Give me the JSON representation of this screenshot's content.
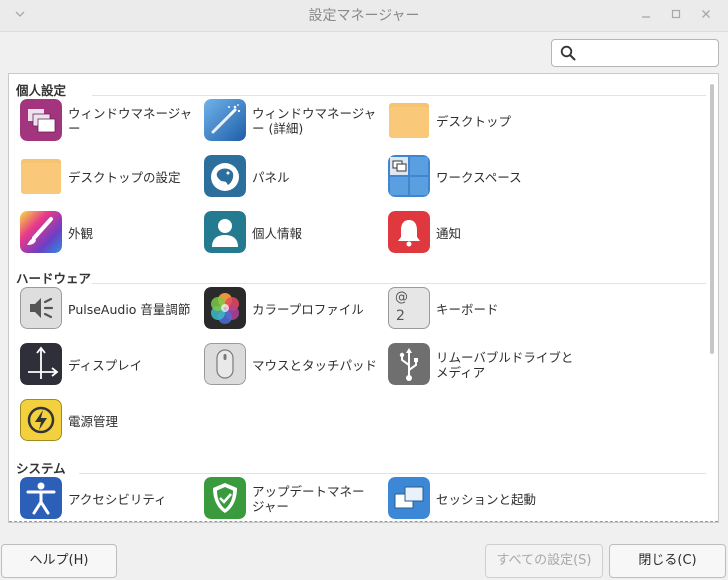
{
  "window": {
    "title": "設定マネージャー"
  },
  "search": {
    "value": "",
    "placeholder": ""
  },
  "categories": {
    "personal": {
      "title": "個人設定",
      "items": [
        {
          "label": "ウィンドウマネージャー",
          "icon": "window-manager-icon"
        },
        {
          "label": "ウィンドウマネージャー (詳細)",
          "icon": "window-manager-tweaks-icon"
        },
        {
          "label": "デスクトップ",
          "icon": "desktop-folder-icon"
        },
        {
          "label": "デスクトップの設定",
          "icon": "desktop-settings-folder-icon"
        },
        {
          "label": "パネル",
          "icon": "panel-icon"
        },
        {
          "label": "ワークスペース",
          "icon": "workspaces-icon"
        },
        {
          "label": "外観",
          "icon": "appearance-icon"
        },
        {
          "label": "個人情報",
          "icon": "user-info-icon"
        },
        {
          "label": "通知",
          "icon": "notification-bell-icon"
        }
      ]
    },
    "hardware": {
      "title": "ハードウェア",
      "items": [
        {
          "label": "PulseAudio 音量調節",
          "icon": "speaker-icon"
        },
        {
          "label": "カラープロファイル",
          "icon": "color-profile-icon"
        },
        {
          "label": "キーボード",
          "icon": "keyboard-key-icon",
          "key_top": "@",
          "key_bottom": "2"
        },
        {
          "label": "ディスプレイ",
          "icon": "display-icon"
        },
        {
          "label": "マウスとタッチパッド",
          "icon": "mouse-icon"
        },
        {
          "label": "リムーバブルドライブとメディア",
          "icon": "usb-icon"
        },
        {
          "label": "電源管理",
          "icon": "power-icon"
        }
      ]
    },
    "system": {
      "title": "システム",
      "items": [
        {
          "label": "アクセシビリティ",
          "icon": "accessibility-icon"
        },
        {
          "label": "アップデートマネージャー",
          "icon": "update-shield-icon"
        },
        {
          "label": "セッションと起動",
          "icon": "session-icon"
        }
      ]
    }
  },
  "buttons": {
    "help": "ヘルプ(H)",
    "all_settings": "すべての設定(S)",
    "close": "閉じる(C)"
  }
}
